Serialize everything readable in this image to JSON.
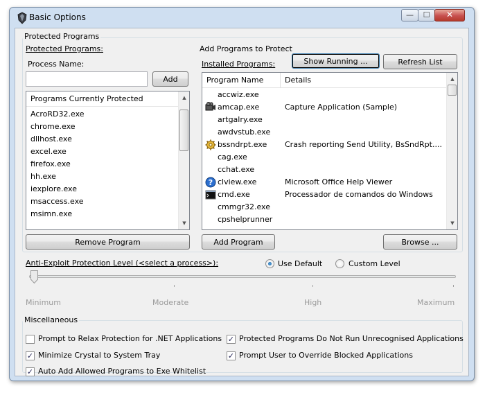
{
  "window": {
    "title": "Basic Options"
  },
  "title_controls": {
    "minimize": "—",
    "maximize": "☐",
    "close": "✕"
  },
  "protected_programs": {
    "group_label": "Protected Programs",
    "section_label": "Protected Programs:",
    "process_name_label": "Process Name:",
    "process_name_value": "",
    "add_button": "Add",
    "list_header": "Programs Currently Protected",
    "items": [
      "AcroRD32.exe",
      "chrome.exe",
      "dllhost.exe",
      "excel.exe",
      "firefox.exe",
      "hh.exe",
      "iexplore.exe",
      "msaccess.exe",
      "msimn.exe"
    ],
    "remove_button": "Remove Program"
  },
  "add_programs": {
    "label": "Add Programs to Protect",
    "installed_label": "Installed Programs:",
    "show_running_button": "Show Running ...",
    "refresh_button": "Refresh List",
    "columns": [
      "Program Name",
      "Details"
    ],
    "rows": [
      {
        "name": "accwiz.exe",
        "details": "",
        "icon": "none"
      },
      {
        "name": "amcap.exe",
        "details": "Capture Application (Sample)",
        "icon": "camera-icon"
      },
      {
        "name": "artgalry.exe",
        "details": "",
        "icon": "none"
      },
      {
        "name": "awdvstub.exe",
        "details": "",
        "icon": "none"
      },
      {
        "name": "bssndrpt.exe",
        "details": "Crash reporting Send Utility, BsSndRpt....",
        "icon": "gear-icon"
      },
      {
        "name": "cag.exe",
        "details": "",
        "icon": "none"
      },
      {
        "name": "cchat.exe",
        "details": "",
        "icon": "none"
      },
      {
        "name": "clview.exe",
        "details": "Microsoft Office Help Viewer",
        "icon": "help-icon"
      },
      {
        "name": "cmd.exe",
        "details": "Processador de comandos do Windows",
        "icon": "console-icon"
      },
      {
        "name": "cmmgr32.exe",
        "details": "",
        "icon": "none"
      },
      {
        "name": "cpshelprunner",
        "details": "",
        "icon": "none"
      }
    ],
    "add_program_button": "Add Program",
    "browse_button": "Browse ..."
  },
  "anti_exploit": {
    "label": "Anti-Exploit Protection Level (<select a process>):",
    "use_default_label": "Use Default",
    "custom_level_label": "Custom Level",
    "use_default_selected": true,
    "levels": [
      "Minimum",
      "Moderate",
      "High",
      "Maximum"
    ],
    "slider_value": 0
  },
  "misc": {
    "group_label": "Miscellaneous",
    "options": [
      {
        "label": "Prompt to Relax Protection for .NET Applications",
        "checked": false
      },
      {
        "label": "Minimize Crystal to System Tray",
        "checked": true
      },
      {
        "label": "Auto Add Allowed Programs to Exe Whitelist",
        "checked": true
      },
      {
        "label": "Protected Programs Do Not Run Unrecognised Applications",
        "checked": true
      },
      {
        "label": "Prompt User to Override Blocked Applications",
        "checked": true
      }
    ]
  },
  "colors": {
    "window_frame": "#cfdff1",
    "client_bg": "#f0f0f0",
    "radio_dot": "#1b5f9c"
  }
}
